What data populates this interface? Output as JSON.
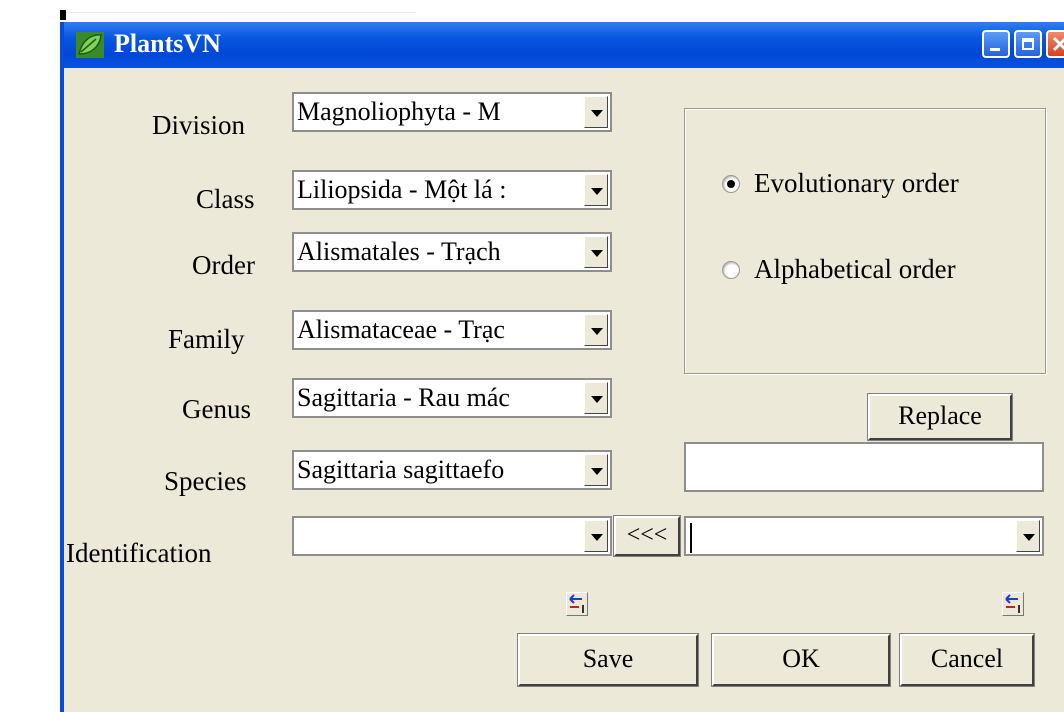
{
  "window": {
    "title": "PlantsVN"
  },
  "fields": [
    {
      "label": "Division",
      "value": "Magnoliophyta - M"
    },
    {
      "label": "Class",
      "value": "Liliopsida - Một lá :"
    },
    {
      "label": "Order",
      "value": "Alismatales - Trạch"
    },
    {
      "label": "Family",
      "value": "Alismataceae - Trạc"
    },
    {
      "label": "Genus",
      "value": "Sagittaria - Rau mác"
    },
    {
      "label": "Species",
      "value": "Sagittaria sagittaefo"
    }
  ],
  "identification": {
    "label": "Identification",
    "value": "",
    "copy_label": "<<<",
    "right_value": ""
  },
  "sort_options": [
    {
      "label": "Evolutionary order",
      "selected": true
    },
    {
      "label": "Alphabetical order",
      "selected": false
    }
  ],
  "replace": {
    "label": "Replace",
    "input_value": ""
  },
  "buttons": {
    "save": "Save",
    "ok": "OK",
    "cancel": "Cancel"
  },
  "colors": {
    "titlebar": "#0047d6",
    "face": "#ece9d8",
    "close": "#d8411f"
  }
}
